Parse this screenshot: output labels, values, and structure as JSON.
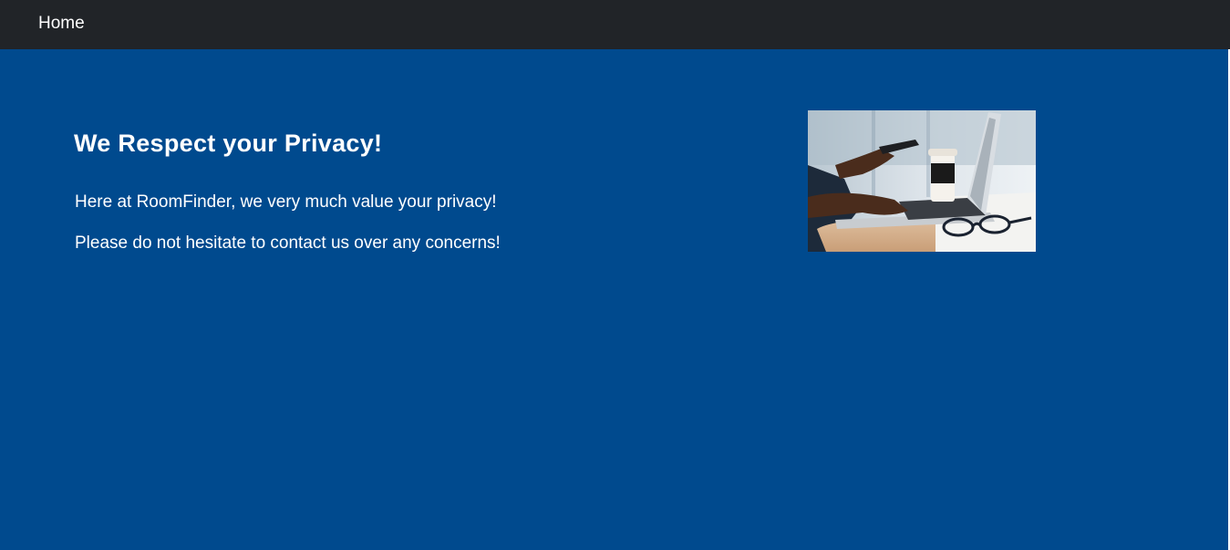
{
  "nav": {
    "home_label": "Home"
  },
  "content": {
    "heading": "We Respect your Privacy!",
    "paragraphs": [
      "Here at RoomFinder, we very much value your privacy!",
      "Please do not hesitate to contact us over any concerns!"
    ]
  },
  "colors": {
    "navbar_bg": "#212428",
    "page_bg": "#004a8e",
    "text": "#ffffff"
  }
}
